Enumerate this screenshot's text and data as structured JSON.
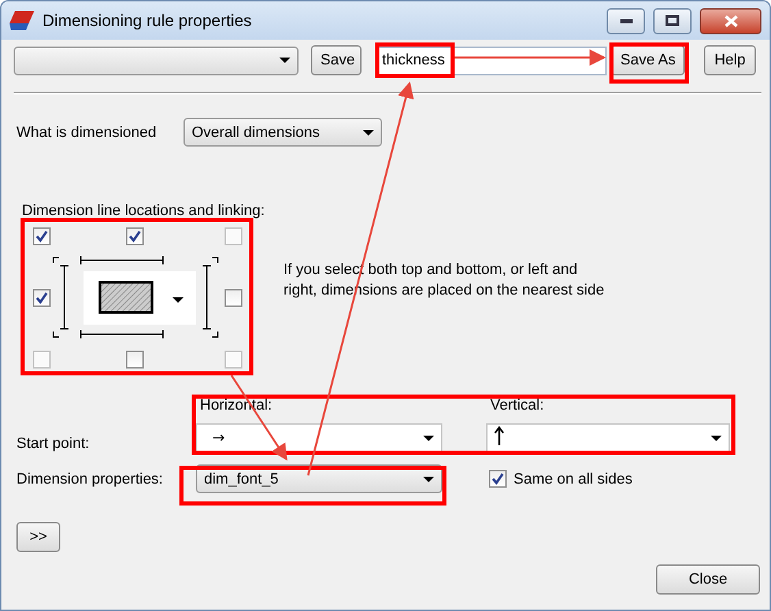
{
  "window": {
    "title": "Dimensioning rule properties"
  },
  "toolbar": {
    "save": "Save",
    "name_field": {
      "value": "thickness"
    },
    "save_as": "Save As",
    "help": "Help"
  },
  "what_dimensioned": {
    "label": "What is dimensioned",
    "value": "Overall dimensions"
  },
  "locations": {
    "label": "Dimension line locations and linking:",
    "checkboxes": [
      {
        "checked": true,
        "disabled": false
      },
      {
        "checked": true,
        "disabled": false
      },
      {
        "checked": false,
        "disabled": true
      },
      {
        "checked": true,
        "disabled": false
      },
      {
        "checked": false,
        "disabled": false
      },
      {
        "checked": false,
        "disabled": true
      },
      {
        "checked": false,
        "disabled": false
      },
      {
        "checked": false,
        "disabled": true
      }
    ],
    "note": "If you select both top and bottom, or left and right, dimensions are placed on the nearest side"
  },
  "start_point": {
    "label": "Start point:",
    "horizontal_label": "Horizontal:",
    "horizontal_value": "→",
    "vertical_label": "Vertical:"
  },
  "dimension_properties": {
    "label": "Dimension properties:",
    "value": "dim_font_5",
    "same_on_all_sides": {
      "label": "Same on all sides",
      "checked": true
    }
  },
  "expand_button": ">>",
  "close": "Close"
}
